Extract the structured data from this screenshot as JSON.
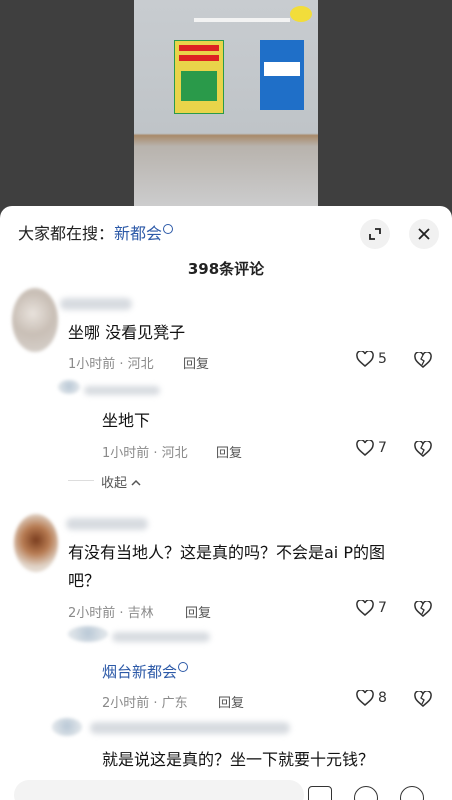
{
  "search": {
    "prefix": "大家都在搜：",
    "keyword": "新都会"
  },
  "comments_count": "398条评论",
  "comments": [
    {
      "text": "坐哪 没看见凳子",
      "time_loc": "1小时前 · 河北",
      "reply": "回复",
      "likes": "5"
    },
    {
      "text": "坐地下",
      "time_loc": "1小时前 · 河北",
      "reply": "回复",
      "likes": "7"
    },
    {
      "text_line1": "有没有当地人？这是真的吗？不会是ai P的图",
      "text_line2": "吧？",
      "time_loc": "2小时前 · 吉林",
      "reply": "回复",
      "likes": "7"
    },
    {
      "text": "烟台新都会",
      "time_loc": "2小时前 · 广东",
      "reply": "回复",
      "likes": "8"
    },
    {
      "text": "就是说这是真的？坐一下就要十元钱？"
    }
  ],
  "collapse_label": "收起",
  "colors": {
    "link": "#2d5aa8",
    "sheet": "#ffffff"
  }
}
